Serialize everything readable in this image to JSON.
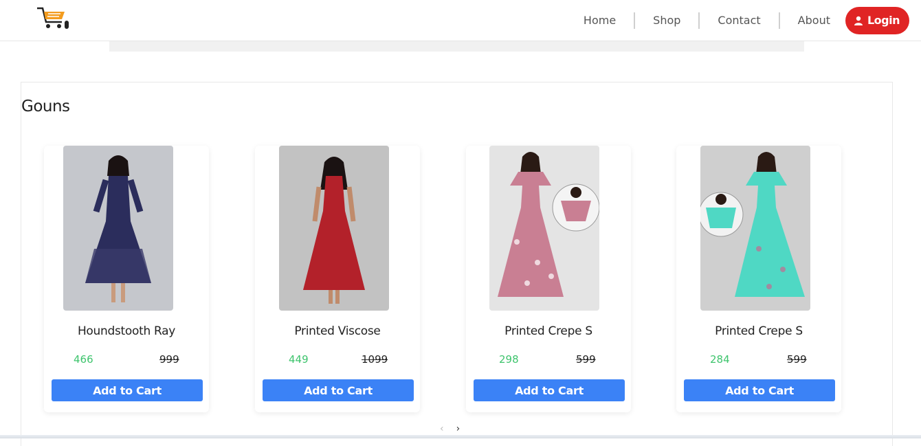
{
  "nav": {
    "links": [
      "Home",
      "Shop",
      "Contact",
      "About"
    ],
    "login_label": "Login"
  },
  "section": {
    "title": "Gouns"
  },
  "products": [
    {
      "name": "Houndstooth Ray",
      "price": "466",
      "mrp": "999",
      "dress_color": "#2b2d5c"
    },
    {
      "name": "Printed Viscose",
      "price": "449",
      "mrp": "1099",
      "dress_color": "#b3212a"
    },
    {
      "name": "Printed Crepe S",
      "price": "298",
      "mrp": "599",
      "dress_color": "#c97f93"
    },
    {
      "name": "Printed Crepe S",
      "price": "284",
      "mrp": "599",
      "dress_color": "#4fd8c4"
    }
  ],
  "cart_label": "Add to Cart",
  "colors": {
    "login": "#e02424",
    "cart_button": "#3b82f6",
    "price": "#3ec46d"
  }
}
